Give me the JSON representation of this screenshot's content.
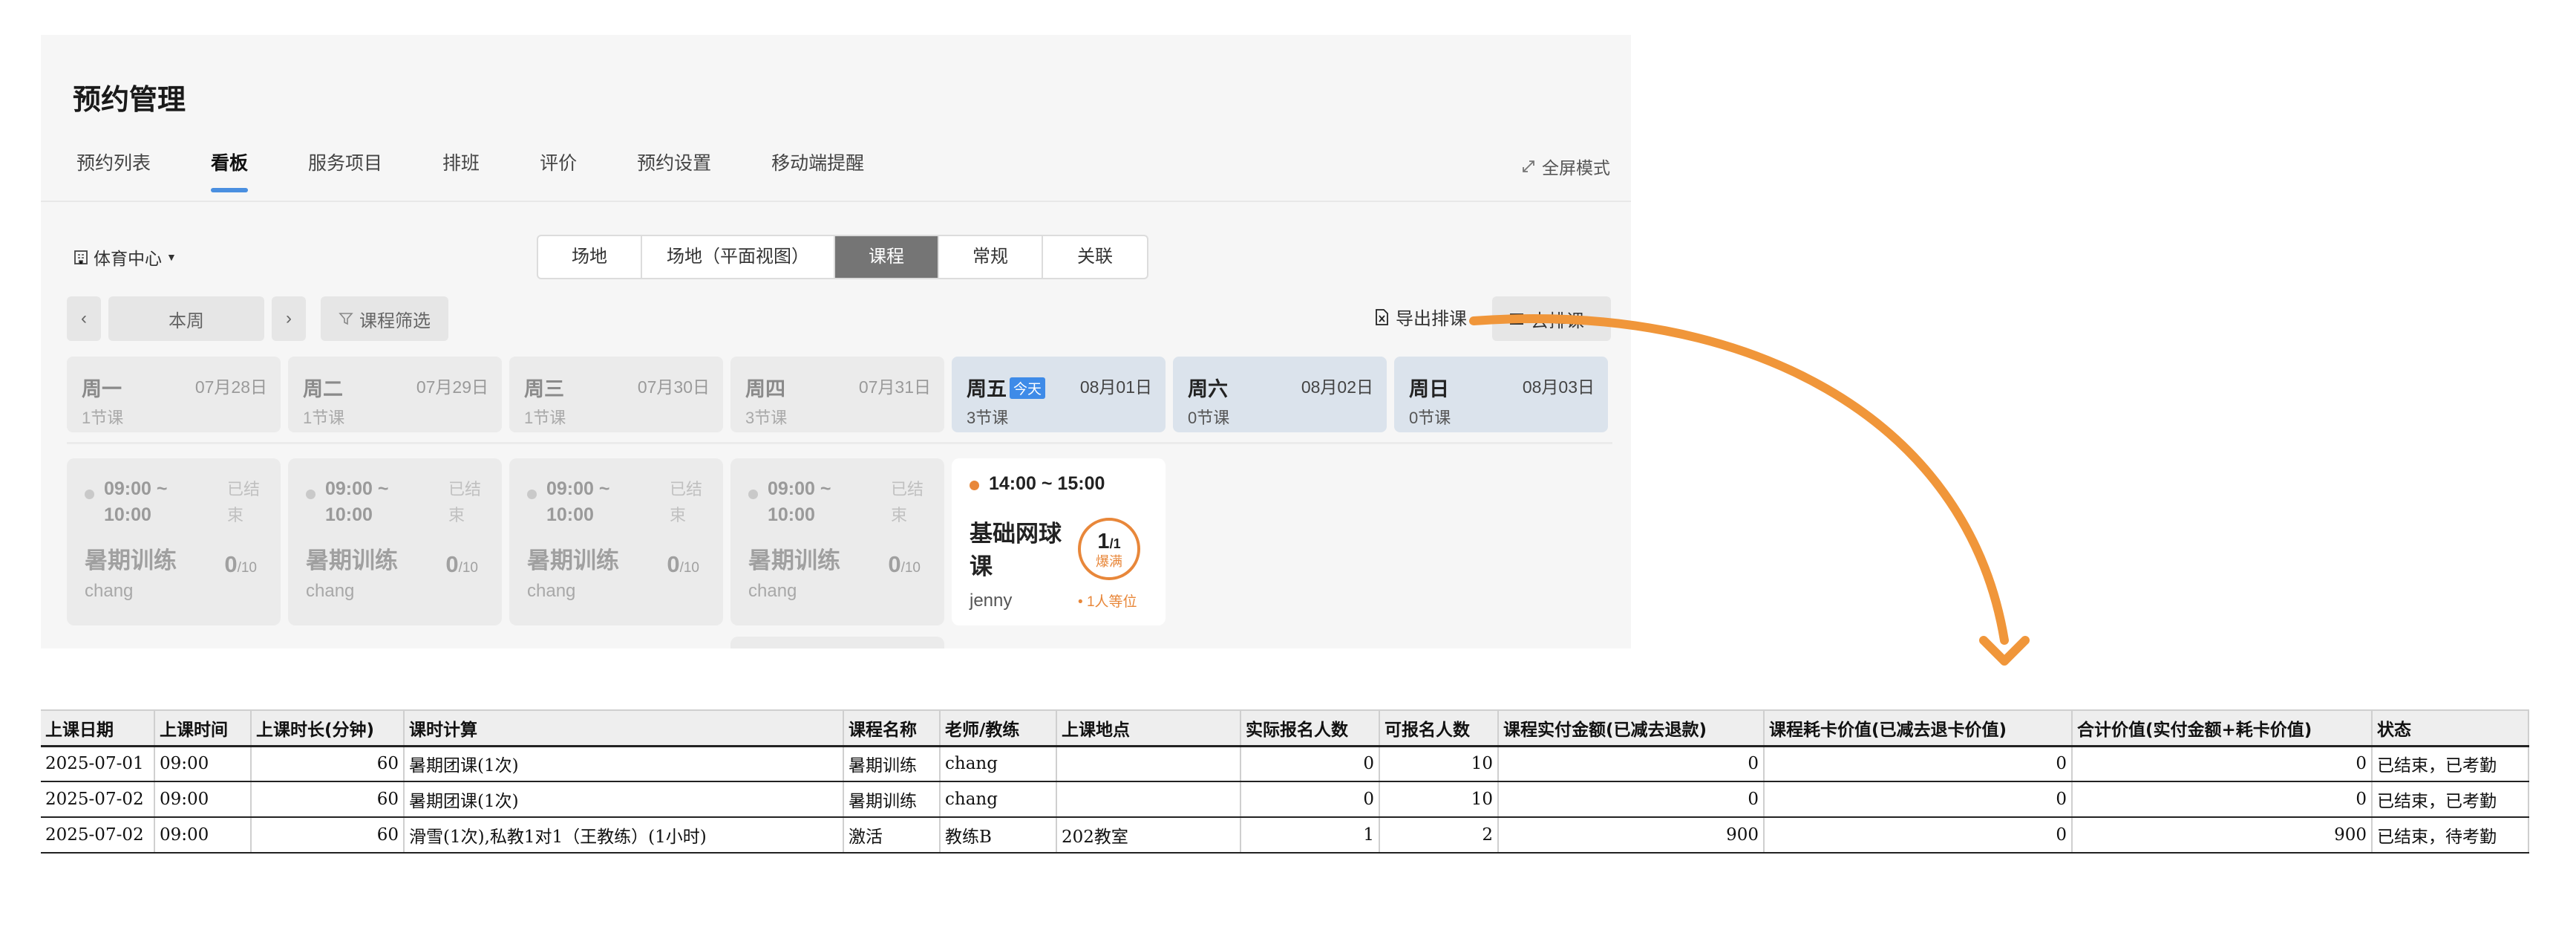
{
  "page_title": "预约管理",
  "tabs": [
    {
      "label": "预约列表",
      "active": false
    },
    {
      "label": "看板",
      "active": true
    },
    {
      "label": "服务项目",
      "active": false
    },
    {
      "label": "排班",
      "active": false
    },
    {
      "label": "评价",
      "active": false
    },
    {
      "label": "预约设置",
      "active": false
    },
    {
      "label": "移动端提醒",
      "active": false
    }
  ],
  "fullscreen_label": "全屏模式",
  "venue_select": "体育中心",
  "view_modes": [
    {
      "label": "场地",
      "active": false
    },
    {
      "label": "场地（平面视图）",
      "active": false
    },
    {
      "label": "课程",
      "active": true
    },
    {
      "label": "常规",
      "active": false
    },
    {
      "label": "关联",
      "active": false
    }
  ],
  "week_nav": {
    "prev": "‹",
    "current": "本周",
    "next": "›",
    "filter": "课程筛选"
  },
  "actions": {
    "export": "导出排课",
    "remove": "去排课"
  },
  "days": [
    {
      "name": "周一",
      "date": "07月28日",
      "count": "1节课",
      "today": false,
      "highlight": false
    },
    {
      "name": "周二",
      "date": "07月29日",
      "count": "1节课",
      "today": false,
      "highlight": false
    },
    {
      "name": "周三",
      "date": "07月30日",
      "count": "1节课",
      "today": false,
      "highlight": false
    },
    {
      "name": "周四",
      "date": "07月31日",
      "count": "3节课",
      "today": false,
      "highlight": false
    },
    {
      "name": "周五",
      "date": "08月01日",
      "count": "3节课",
      "today": true,
      "highlight": true
    },
    {
      "name": "周六",
      "date": "08月02日",
      "count": "0节课",
      "today": false,
      "highlight": true
    },
    {
      "name": "周日",
      "date": "08月03日",
      "count": "0节课",
      "today": false,
      "highlight": true
    }
  ],
  "today_label": "今天",
  "cards": [
    {
      "time": "09:00 ~ 10:00",
      "status": "已结束",
      "course": "暑期训练",
      "teacher": "chang",
      "booked": "0",
      "capacity": "/10"
    },
    {
      "time": "09:00 ~ 10:00",
      "status": "已结束",
      "course": "暑期训练",
      "teacher": "chang",
      "booked": "0",
      "capacity": "/10"
    },
    {
      "time": "09:00 ~ 10:00",
      "status": "已结束",
      "course": "暑期训练",
      "teacher": "chang",
      "booked": "0",
      "capacity": "/10"
    },
    {
      "time": "09:00 ~ 10:00",
      "status": "已结束",
      "course": "暑期训练",
      "teacher": "chang",
      "booked": "0",
      "capacity": "/10"
    }
  ],
  "active_card": {
    "time": "14:00 ~ 15:00",
    "course": "基础网球课",
    "teacher": "jenny",
    "booked": "1",
    "capacity": "/1",
    "full_label": "爆满",
    "waitlist": "1人等位"
  },
  "colors": {
    "accent": "#4a8fe0",
    "orange": "#e8873a",
    "segment_active": "#757575",
    "today_badge": "#3e8be8"
  },
  "export_table": {
    "headers": [
      "上课日期",
      "上课时间",
      "上课时长(分钟)",
      "课时计算",
      "课程名称",
      "老师/教练",
      "上课地点",
      "实际报名人数",
      "可报名人数",
      "课程实付金额(已减去退款)",
      "课程耗卡价值(已减去退卡价值)",
      "合计价值(实付金额+耗卡价值)",
      "状态"
    ],
    "rows": [
      [
        "2025-07-01",
        "09:00",
        "60",
        "暑期团课(1次)",
        "暑期训练",
        "chang",
        "",
        "0",
        "10",
        "0",
        "0",
        "0",
        "已结束，已考勤"
      ],
      [
        "2025-07-02",
        "09:00",
        "60",
        "暑期团课(1次)",
        "暑期训练",
        "chang",
        "",
        "0",
        "10",
        "0",
        "0",
        "0",
        "已结束，已考勤"
      ],
      [
        "2025-07-02",
        "09:00",
        "60",
        "滑雪(1次),私教1对1（王教练）(1小时)",
        "激活",
        "教练B",
        "202教室",
        "1",
        "2",
        "900",
        "0",
        "900",
        "已结束，待考勤"
      ]
    ]
  }
}
